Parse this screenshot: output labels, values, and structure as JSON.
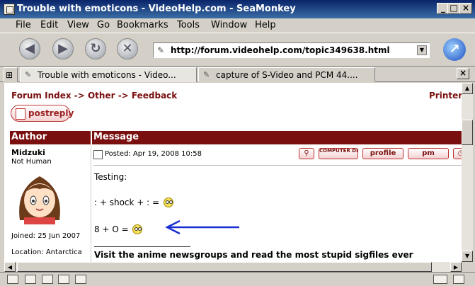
{
  "window": {
    "title": "Trouble with emoticons - VideoHelp.com - SeaMonkey"
  },
  "menus": [
    "File",
    "Edit",
    "View",
    "Go",
    "Bookmarks",
    "Tools",
    "Window",
    "Help"
  ],
  "nav": {
    "url": "http://forum.videohelp.com/topic349638.html"
  },
  "tabs": [
    "Trouble with emoticons - Video...",
    "capture of S-Video and PCM 44...."
  ],
  "page": {
    "breadcrumb": {
      "forum_index": "Forum Index",
      "arrow1": " -> ",
      "other": "Other",
      "arrow2": " -> ",
      "feedback": "Feedback"
    },
    "printer": "Printer",
    "post_reply": "postreply",
    "table_headers": {
      "author": "Author",
      "message": "Message"
    },
    "post": {
      "author": "Midzuki",
      "rank": "Not Human",
      "joined": "Joined: 25 Jun 2007",
      "location": "Location: Antarctica",
      "posted": "Posted: Apr 19, 2008 10:58",
      "buttons": [
        "COMPUTER DETAILS",
        "profile",
        "pm"
      ],
      "lines": [
        "Testing:",
        ": + shock + : =",
        "8 + O ="
      ],
      "signature": "Visit the anime newsgroups and read the most stupid sigfiles ever"
    }
  },
  "colors": {
    "accent": "#7a0f0f",
    "arrow": "#1a2fd0"
  }
}
